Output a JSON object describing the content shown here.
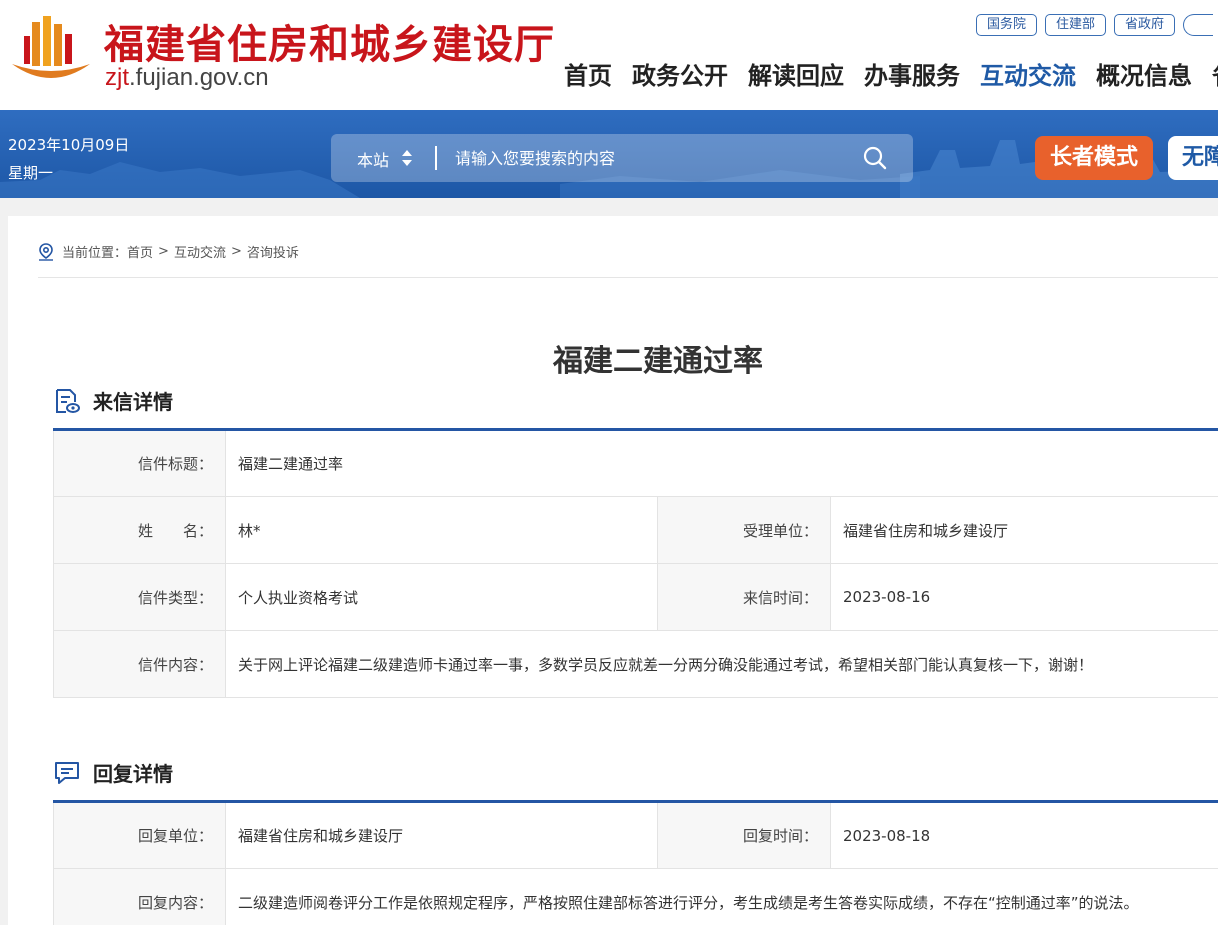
{
  "header": {
    "site_title": "福建省住房和城乡建设厅",
    "domain_main": "zjt",
    "domain_rest": ".fujian.gov.cn",
    "top_links": [
      "国务院",
      "住建部",
      "省政府"
    ],
    "nav": [
      "首页",
      "政务公开",
      "解读回应",
      "办事服务",
      "互动交流",
      "概况信息",
      "省"
    ],
    "nav_active_index": 4,
    "brand_color": "#c8151b",
    "accent_color": "#1f5aa6"
  },
  "banner": {
    "date": "2023年10月09日",
    "weekday": "星期一",
    "search_scope": "本站",
    "search_placeholder": "请输入您要搜索的内容",
    "elder_mode": "长者模式",
    "accessibility": "无障碍"
  },
  "breadcrumb": {
    "prefix": "当前位置：",
    "items": [
      "首页",
      "互动交流",
      "咨询投诉"
    ],
    "separator": ">"
  },
  "page_title": "福建二建通过率",
  "letter": {
    "section_title": "来信详情",
    "subject_label": "信件标题：",
    "subject_value": "福建二建通过率",
    "name_label": "姓　　名：",
    "name_value": "林*",
    "unit_label": "受理单位：",
    "unit_value": "福建省住房和城乡建设厅",
    "type_label": "信件类型：",
    "type_value": "个人执业资格考试",
    "time_label": "来信时间：",
    "time_value": "2023-08-16",
    "content_label": "信件内容：",
    "content_value": "关于网上评论福建二级建造师卡通过率一事，多数学员反应就差一分两分确没能通过考试，希望相关部门能认真复核一下，谢谢！"
  },
  "reply": {
    "section_title": "回复详情",
    "unit_label": "回复单位：",
    "unit_value": "福建省住房和城乡建设厅",
    "time_label": "回复时间：",
    "time_value": "2023-08-18",
    "content_label": "回复内容：",
    "content_value": "二级建造师阅卷评分工作是依照规定程序，严格按照住建部标答进行评分，考生成绩是考生答卷实际成绩，不存在“控制通过率”的说法。"
  }
}
